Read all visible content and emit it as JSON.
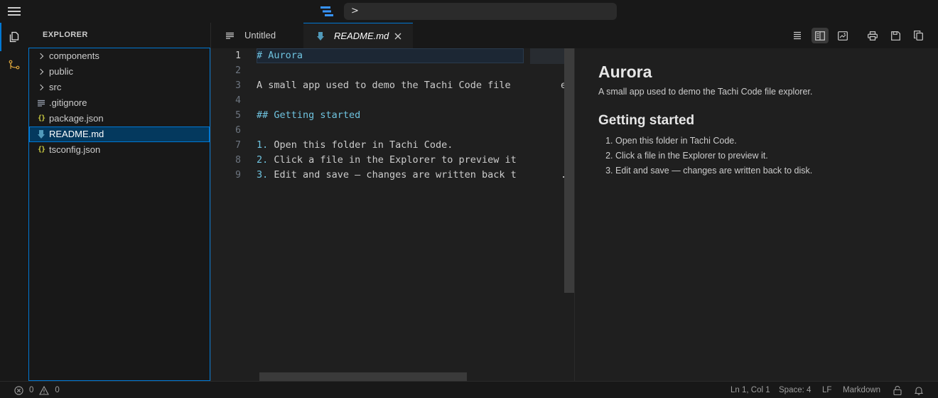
{
  "titlebar": {
    "command_text": ">"
  },
  "sidebar": {
    "title": "EXPLORER",
    "items": [
      {
        "label": "components",
        "kind": "folder"
      },
      {
        "label": "public",
        "kind": "folder"
      },
      {
        "label": "src",
        "kind": "folder"
      },
      {
        "label": ".gitignore",
        "kind": "file-lines"
      },
      {
        "label": "package.json",
        "kind": "json"
      },
      {
        "label": "README.md",
        "kind": "markdown",
        "selected": true
      },
      {
        "label": "tsconfig.json",
        "kind": "json"
      }
    ]
  },
  "tabs": [
    {
      "label": "Untitled"
    },
    {
      "label": "README.md",
      "active": true
    }
  ],
  "editor": {
    "line_numbers": [
      "1",
      "2",
      "3",
      "4",
      "5",
      "6",
      "7",
      "8",
      "9"
    ],
    "lines": {
      "l1": "# Aurora",
      "l3": "A small app used to demo the Tachi Code file",
      "l3b": "er",
      "l5": "## Getting started",
      "l7n": "1.",
      "l7": " Open this folder in Tachi Code.",
      "l8n": "2.",
      "l8": " Click a file in the Explorer to preview it",
      "l9n": "3.",
      "l9": " Edit and save — changes are written back t",
      "l9b": "."
    }
  },
  "preview": {
    "h1": "Aurora",
    "p": "A small app used to demo the Tachi Code file explorer.",
    "h2": "Getting started",
    "items": [
      "Open this folder in Tachi Code.",
      "Click a file in the Explorer to preview it.",
      "Edit and save — changes are written back to disk."
    ]
  },
  "statusbar": {
    "errors": "0",
    "warnings": "0",
    "position": "Ln 1, Col 1",
    "spaces": "Space: 4",
    "eol": "LF",
    "language": "Markdown"
  },
  "colors": {
    "accent": "#0078d4",
    "markdown_syntax": "#6fc3df",
    "json_icon": "#cbcb41",
    "markdown_icon": "#519aba"
  }
}
